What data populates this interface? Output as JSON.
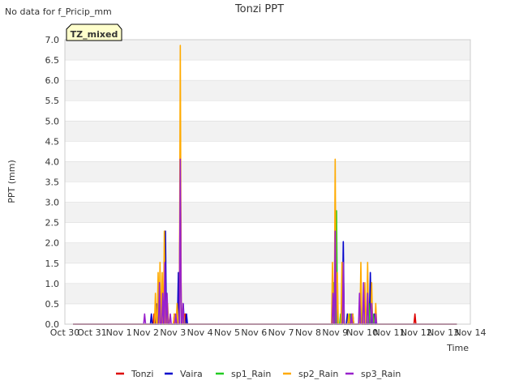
{
  "no_data_note": "No data for f_Pricip_mm",
  "badge_label": "TZ_mixed",
  "colors": {
    "band": "#f2f2f2",
    "grid": "#dddddd",
    "badge_bg": "#ffffcc",
    "badge_text": "#990000",
    "Tonzi": "#dd0000",
    "Vaira": "#0000cc",
    "sp1_Rain": "#22cc22",
    "sp2_Rain": "#ffaa00",
    "sp3_Rain": "#9922cc"
  },
  "chart_data": {
    "type": "line",
    "title": "Tonzi PPT",
    "xlabel": "Time",
    "ylabel": "PPT (mm)",
    "x_unit": "days since Oct 30",
    "xlim": [
      0,
      15
    ],
    "ylim": [
      0,
      7.0
    ],
    "yticks": [
      0,
      0.5,
      1.0,
      1.5,
      2.0,
      2.5,
      3.0,
      3.5,
      4.0,
      4.5,
      5.0,
      5.5,
      6.0,
      6.5,
      7.0
    ],
    "ytick_labels": [
      "0.0",
      "0.5",
      "1.0",
      "1.5",
      "2.0",
      "2.5",
      "3.0",
      "3.5",
      "4.0",
      "4.5",
      "5.0",
      "5.5",
      "6.0",
      "6.5",
      "7.0"
    ],
    "xtick_labels": [
      "Oct 30",
      "Oct 31",
      "Nov 1",
      "Nov 2",
      "Nov 3",
      "Nov 4",
      "Nov 5",
      "Nov 6",
      "Nov 7",
      "Nov 8",
      "Nov 9",
      "Nov 10",
      "Nov 11",
      "Nov 12",
      "Nov 13",
      "Nov 14"
    ],
    "grid": true,
    "legend_position": "bottom",
    "x_start": 0.3,
    "x_end": 14.5,
    "series": [
      {
        "name": "Tonzi",
        "color": "#dd0000",
        "events": [
          [
            3.3,
            0.25
          ],
          [
            3.5,
            0.75
          ],
          [
            3.65,
            0.5
          ],
          [
            4.05,
            0.25
          ],
          [
            4.27,
            4.57
          ],
          [
            4.45,
            0.25
          ],
          [
            9.95,
            0.75
          ],
          [
            10.3,
            0.5
          ],
          [
            10.95,
            0.75
          ],
          [
            12.95,
            0.25
          ]
        ]
      },
      {
        "name": "Vaira",
        "color": "#0000cc",
        "events": [
          [
            3.2,
            0.25
          ],
          [
            3.4,
            0.5
          ],
          [
            3.6,
            0.5
          ],
          [
            3.72,
            2.29
          ],
          [
            3.8,
            0.25
          ],
          [
            4.2,
            1.27
          ],
          [
            4.27,
            4.07
          ],
          [
            4.38,
            0.5
          ],
          [
            4.5,
            0.25
          ],
          [
            9.95,
            0.76
          ],
          [
            10.02,
            2.29
          ],
          [
            10.3,
            2.03
          ],
          [
            10.45,
            0.25
          ],
          [
            10.65,
            0.25
          ],
          [
            10.95,
            0.51
          ],
          [
            11.3,
            1.27
          ],
          [
            11.45,
            0.25
          ]
        ]
      },
      {
        "name": "sp1_Rain",
        "color": "#22cc22",
        "events": [
          [
            3.5,
            0.76
          ],
          [
            3.75,
            0.25
          ],
          [
            9.95,
            1.02
          ],
          [
            10.05,
            2.79
          ],
          [
            10.2,
            0.25
          ],
          [
            10.55,
            0.25
          ],
          [
            10.95,
            1.02
          ],
          [
            11.25,
            0.51
          ],
          [
            11.4,
            0.25
          ]
        ]
      },
      {
        "name": "sp2_Rain",
        "color": "#ffaa00",
        "events": [
          [
            3.35,
            0.76
          ],
          [
            3.45,
            1.27
          ],
          [
            3.52,
            1.52
          ],
          [
            3.6,
            1.27
          ],
          [
            3.68,
            2.29
          ],
          [
            3.8,
            0.51
          ],
          [
            4.05,
            0.25
          ],
          [
            4.15,
            0.51
          ],
          [
            4.27,
            6.86
          ],
          [
            4.4,
            0.25
          ],
          [
            9.9,
            1.52
          ],
          [
            10.0,
            4.06
          ],
          [
            10.08,
            1.27
          ],
          [
            10.25,
            1.52
          ],
          [
            10.5,
            0.25
          ],
          [
            10.65,
            0.25
          ],
          [
            10.95,
            1.52
          ],
          [
            11.1,
            1.02
          ],
          [
            11.2,
            1.52
          ],
          [
            11.35,
            1.02
          ],
          [
            11.5,
            0.51
          ]
        ]
      },
      {
        "name": "sp3_Rain",
        "color": "#9922cc",
        "events": [
          [
            2.95,
            0.25
          ],
          [
            3.5,
            1.02
          ],
          [
            3.62,
            0.76
          ],
          [
            3.7,
            1.52
          ],
          [
            3.78,
            0.76
          ],
          [
            3.9,
            0.25
          ],
          [
            4.1,
            0.25
          ],
          [
            4.27,
            4.06
          ],
          [
            4.37,
            0.51
          ],
          [
            9.92,
            0.76
          ],
          [
            10.0,
            2.29
          ],
          [
            10.3,
            1.52
          ],
          [
            10.6,
            0.25
          ],
          [
            10.9,
            0.76
          ],
          [
            11.05,
            1.02
          ],
          [
            11.2,
            0.76
          ],
          [
            11.35,
            0.51
          ],
          [
            11.5,
            0.25
          ]
        ]
      }
    ]
  }
}
